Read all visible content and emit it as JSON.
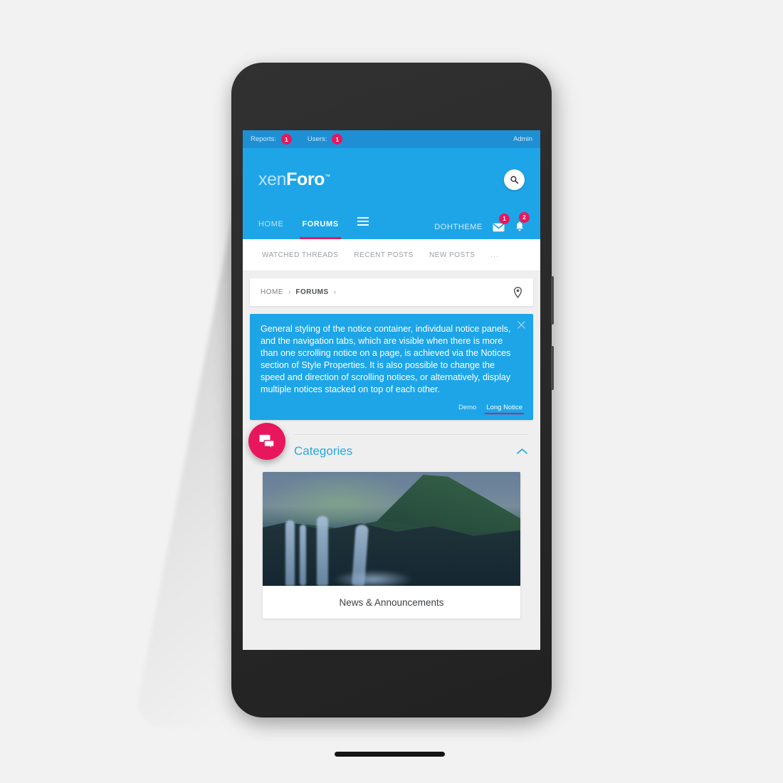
{
  "admin_bar": {
    "items": [
      {
        "label": "Reports:",
        "count": "1",
        "name": "reports"
      },
      {
        "label": "Users:",
        "count": "1",
        "name": "users"
      }
    ],
    "right_label": "Admin"
  },
  "header": {
    "logo_thin": "xen",
    "logo_bold": "Foro",
    "logo_tm": "™",
    "search_icon": "search-icon"
  },
  "main_nav": {
    "links": [
      {
        "label": "HOME",
        "active": false
      },
      {
        "label": "FORUMS",
        "active": true
      }
    ],
    "menu_icon": "hamburger-menu-icon",
    "user_name": "DOHTHEME",
    "inbox": {
      "icon": "envelope-icon",
      "count": "1"
    },
    "alerts": {
      "icon": "bell-icon",
      "count": "2"
    }
  },
  "sub_nav": {
    "links": [
      "WATCHED THREADS",
      "RECENT POSTS",
      "NEW POSTS"
    ],
    "more": "..."
  },
  "breadcrumb": {
    "items": [
      "HOME",
      "FORUMS"
    ],
    "separator": "›",
    "pin_icon": "map-pin-icon"
  },
  "notice": {
    "close_icon": "close-icon",
    "text": "General styling of the notice container, individual notice panels, and the navigation tabs, which are visible when there is more than one scrolling notice on a page, is achieved via the Notices section of Style Properties. It is also possible to change the speed and direction of scrolling notices, or alternatively, display multiple notices stacked on top of each other.",
    "tabs": [
      {
        "label": "Demo",
        "active": false
      },
      {
        "label": "Long Notice",
        "active": true
      }
    ]
  },
  "categories": {
    "fab_icon": "chat-bubbles-icon",
    "title": "Categories",
    "toggle_icon": "chevron-up-icon",
    "nodes": [
      {
        "title": "News & Announcements",
        "image": "waterfall-mountain-photo"
      }
    ]
  },
  "colors": {
    "brand_blue": "#1da5e8",
    "admin_blue": "#1f8fd4",
    "accent_pink": "#e8175d",
    "page_bg": "#efefef",
    "phone_body": "#262626"
  },
  "device": {
    "camera_icon": "front-camera",
    "speaker_icon": "earpiece-speaker",
    "home_bar_icon": "home-indicator",
    "side_buttons": [
      "power-button",
      "volume-button"
    ]
  }
}
